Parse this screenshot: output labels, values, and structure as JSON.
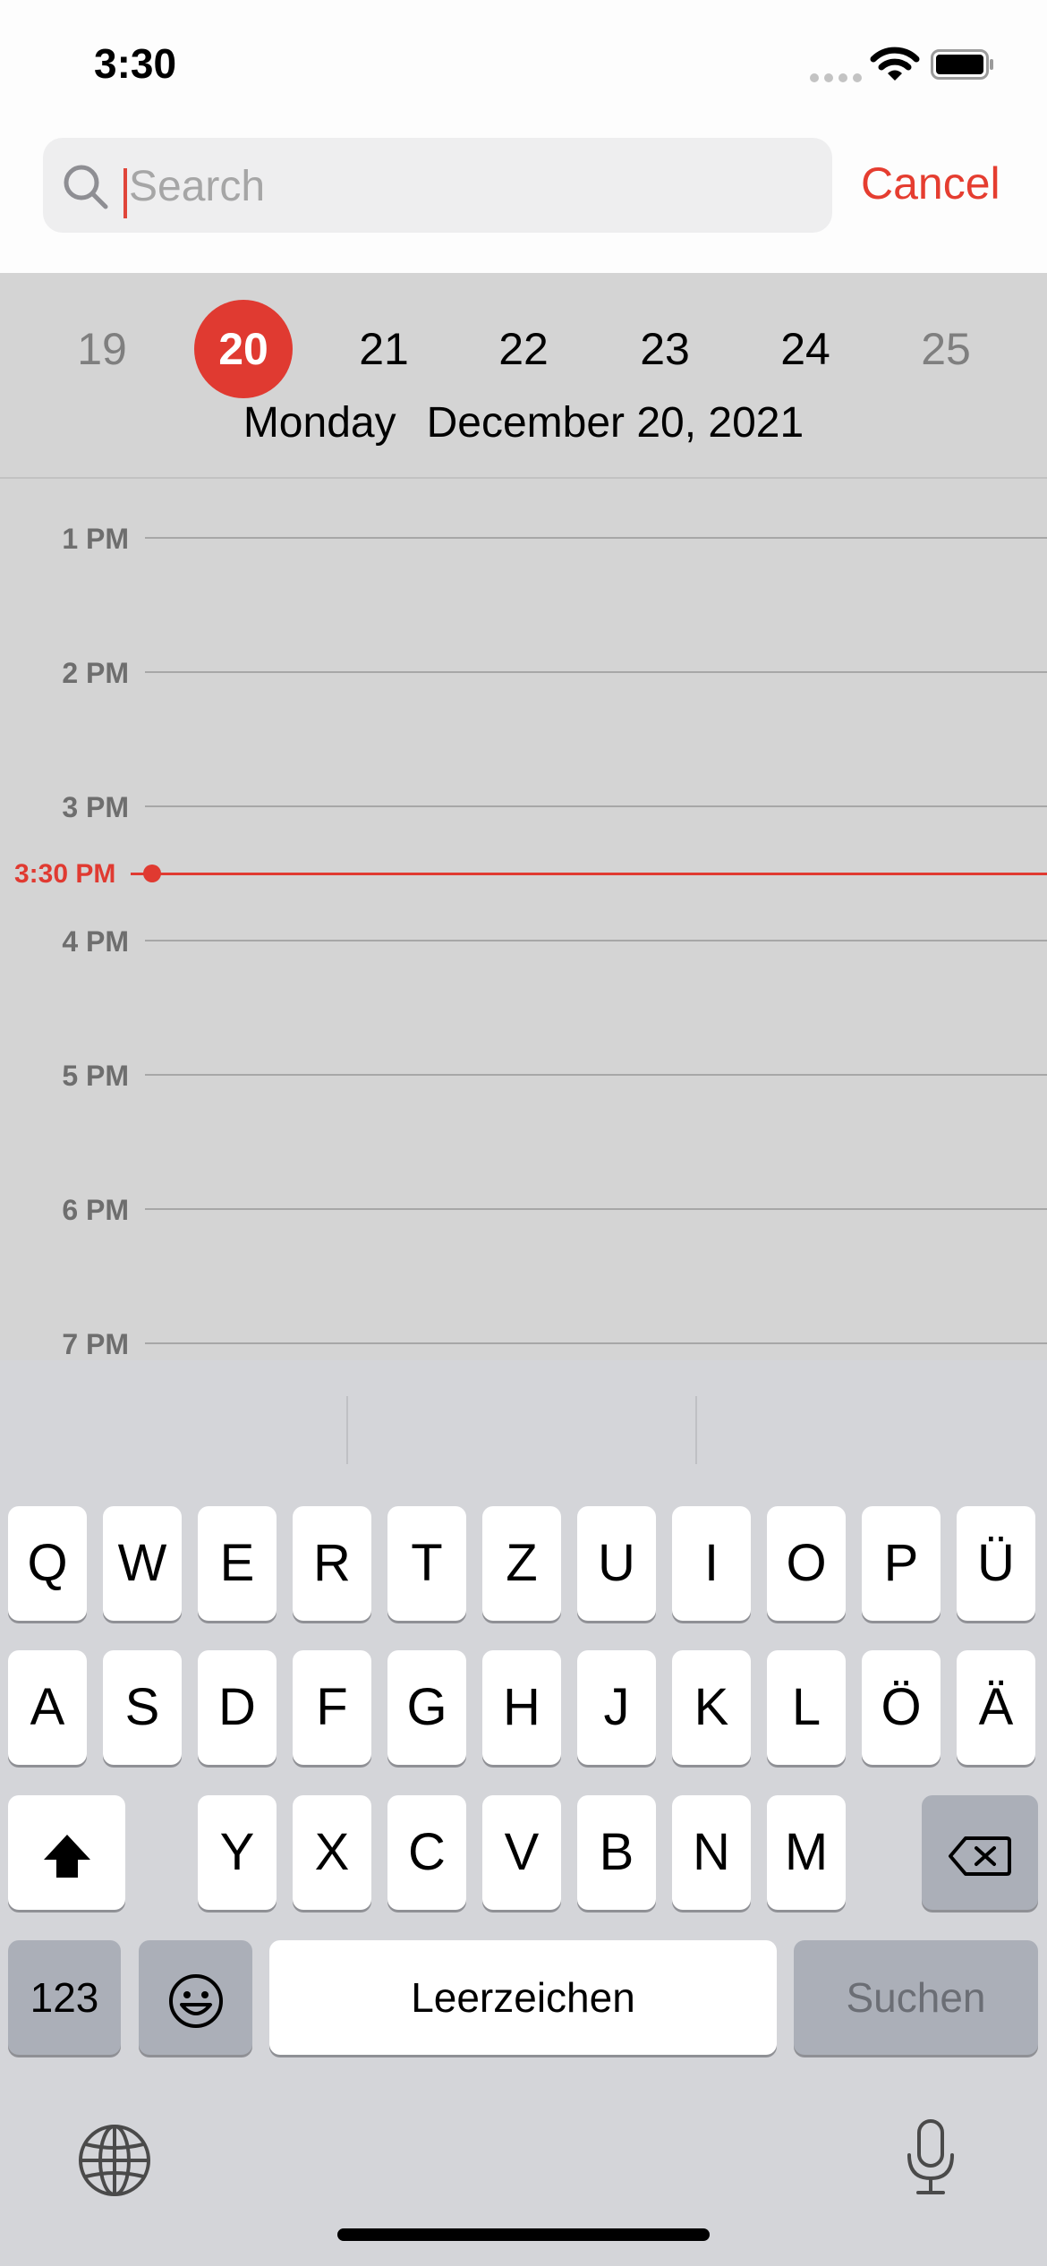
{
  "status_bar": {
    "time": "3:30"
  },
  "search": {
    "placeholder": "Search",
    "value": "",
    "cancel_label": "Cancel"
  },
  "week": {
    "days": [
      "19",
      "20",
      "21",
      "22",
      "23",
      "24",
      "25"
    ],
    "selected_index": 1,
    "weekday": "Monday",
    "date": "December 20, 2021"
  },
  "timeline": {
    "hours": [
      "1 PM",
      "2 PM",
      "3 PM",
      "4 PM",
      "5 PM",
      "6 PM",
      "7 PM"
    ],
    "now_label": "3:30 PM"
  },
  "keyboard": {
    "row1": [
      "Q",
      "W",
      "E",
      "R",
      "T",
      "Z",
      "U",
      "I",
      "O",
      "P",
      "Ü"
    ],
    "row2": [
      "A",
      "S",
      "D",
      "F",
      "G",
      "H",
      "J",
      "K",
      "L",
      "Ö",
      "Ä"
    ],
    "row3": [
      "Y",
      "X",
      "C",
      "V",
      "B",
      "N",
      "M"
    ],
    "numbers_label": "123",
    "space_label": "Leerzeichen",
    "return_label": "Suchen"
  },
  "colors": {
    "accent": "#e03a31",
    "background": "#d4d4d4",
    "keyboard": "#d4d5d9"
  },
  "icons": [
    "search-icon",
    "wifi-icon",
    "battery-icon",
    "shift-icon",
    "delete-icon",
    "emoji-icon",
    "globe-icon",
    "microphone-icon"
  ]
}
